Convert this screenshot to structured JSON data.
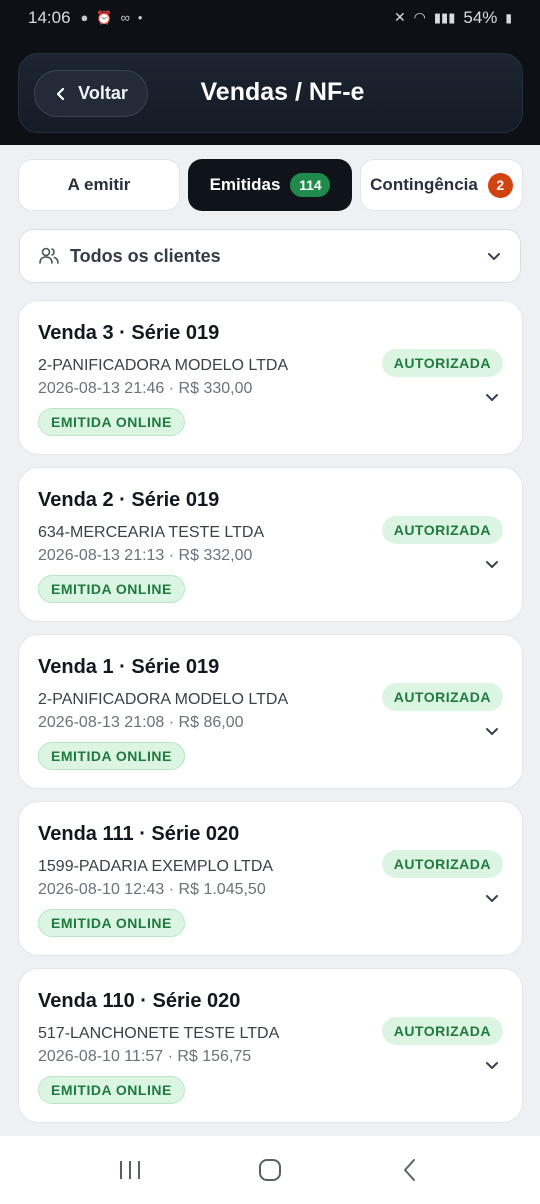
{
  "status_bar": {
    "time": "14:06",
    "battery": "54%"
  },
  "header": {
    "back_label": "Voltar",
    "title": "Vendas / NF-e"
  },
  "tabs": [
    {
      "label": "A emitir",
      "badge": ""
    },
    {
      "label": "Emitidas",
      "badge": "114"
    },
    {
      "label": "Contingência",
      "badge": "2"
    }
  ],
  "filter": {
    "label": "Todos os clientes"
  },
  "sales": [
    {
      "title": "Venda 3 · Série 019",
      "client": "2-PANIFICADORA MODELO LTDA",
      "meta": "2026-08-13 21:46 · R$ 330,00",
      "status": "AUTORIZADA",
      "emission": "EMITIDA ONLINE"
    },
    {
      "title": "Venda 2 · Série 019",
      "client": "634-MERCEARIA TESTE LTDA",
      "meta": "2026-08-13 21:13 · R$ 332,00",
      "status": "AUTORIZADA",
      "emission": "EMITIDA ONLINE"
    },
    {
      "title": "Venda 1 · Série 019",
      "client": "2-PANIFICADORA MODELO LTDA",
      "meta": "2026-08-13 21:08 · R$ 86,00",
      "status": "AUTORIZADA",
      "emission": "EMITIDA ONLINE"
    },
    {
      "title": "Venda 111 · Série 020",
      "client": "1599-PADARIA EXEMPLO LTDA",
      "meta": "2026-08-10 12:43 · R$ 1.045,50",
      "status": "AUTORIZADA",
      "emission": "EMITIDA ONLINE"
    },
    {
      "title": "Venda 110 · Série 020",
      "client": "517-LANCHONETE TESTE LTDA",
      "meta": "2026-08-10 11:57 · R$ 156,75",
      "status": "AUTORIZADA",
      "emission": "EMITIDA ONLINE"
    }
  ],
  "colors": {
    "header_bg": "#0d1116",
    "active_tab": "#0f141b",
    "success_green": "#1f8a4c",
    "warning_orange": "#d2440f",
    "badge_bg": "#dcf5e3"
  },
  "icons": {
    "back": "chevron-left-icon",
    "users": "users-icon",
    "dropdown": "chevron-down-icon",
    "nav_recent": "recent-apps-icon",
    "nav_home": "home-icon",
    "nav_back": "nav-back-icon"
  }
}
